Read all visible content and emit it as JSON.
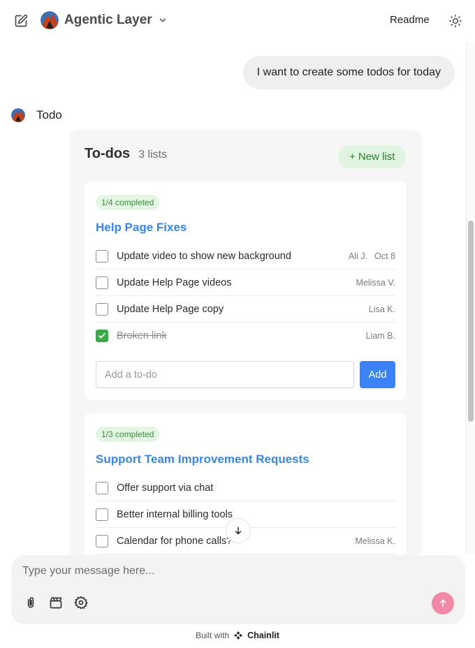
{
  "header": {
    "app_title": "Agentic Layer",
    "readme_label": "Readme"
  },
  "chat": {
    "user_message": "I want to create some todos for today",
    "assistant_name": "Todo"
  },
  "todos": {
    "title": "To-dos",
    "count_label": "3 lists",
    "new_list_label": "+ New list",
    "lists": [
      {
        "badge": "1/4 completed",
        "title": "Help Page Fixes",
        "items": [
          {
            "text": "Update video to show new background",
            "assignee": "Ali J.",
            "date": "Oct 8",
            "done": false
          },
          {
            "text": "Update Help Page videos",
            "assignee": "Melissa V.",
            "date": "",
            "done": false
          },
          {
            "text": "Update Help Page copy",
            "assignee": "Lisa K.",
            "date": "",
            "done": false
          },
          {
            "text": "Broken link",
            "assignee": "Liam B.",
            "date": "",
            "done": true
          }
        ],
        "add_placeholder": "Add a to-do",
        "add_label": "Add"
      },
      {
        "badge": "1/3 completed",
        "title": "Support Team Improvement Requests",
        "items": [
          {
            "text": "Offer support via chat",
            "assignee": "",
            "date": "",
            "done": false
          },
          {
            "text": "Better internal billing tools",
            "assignee": "",
            "date": "",
            "done": false
          },
          {
            "text": "Calendar for phone calls?",
            "assignee": "Melissa K.",
            "date": "",
            "done": false
          }
        ]
      }
    ]
  },
  "composer": {
    "placeholder": "Type your message here..."
  },
  "footer": {
    "built_with": "Built with",
    "brand": "Chainlit"
  },
  "colors": {
    "accent_blue": "#3a86e0",
    "add_button": "#3b82f6",
    "badge_green": "#3c8d40",
    "check_green": "#3aaa48",
    "send_pink": "#f28aa6"
  },
  "icons": {
    "new_chat": "edit-icon",
    "dropdown": "chevron-down-icon",
    "theme": "sun-icon",
    "attach": "paperclip-icon",
    "clapper": "clapperboard-icon",
    "settings": "gear-icon",
    "send": "arrow-up-icon",
    "scroll_down": "arrow-down-icon"
  }
}
